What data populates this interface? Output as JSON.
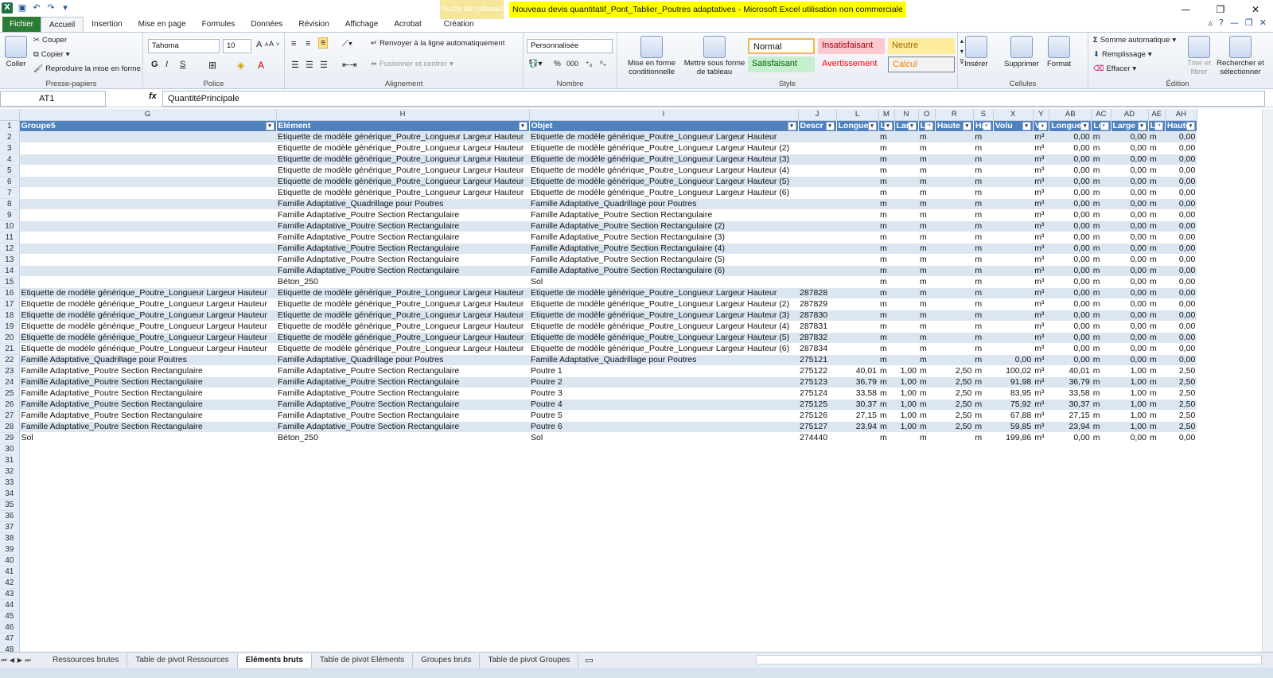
{
  "window": {
    "title": "Nouveau devis quantitatif_Pont_Tablier_Poutres adaptatives  -  Microsoft Excel utilisation non commerciale",
    "context_tab": "Outils de tableau",
    "controls": [
      "—",
      "❐",
      "✕"
    ]
  },
  "tabs": [
    "Fichier",
    "Accueil",
    "Insertion",
    "Mise en page",
    "Formules",
    "Données",
    "Révision",
    "Affichage",
    "Acrobat",
    "Création"
  ],
  "active_tab": "Accueil",
  "ribbon": {
    "clipboard": {
      "paste": "Coller",
      "cut": "Couper",
      "copy": "Copier",
      "format_painter": "Reproduire la mise en forme",
      "label": "Presse-papiers"
    },
    "font": {
      "name": "Tahoma",
      "size": "10",
      "label": "Police"
    },
    "alignment": {
      "wrap": "Renvoyer à la ligne automatiquement",
      "merge": "Fusionner et centrer",
      "label": "Alignement"
    },
    "number": {
      "format": "Personnalisée",
      "label": "Nombre"
    },
    "styles": {
      "conditional": "Mise en forme conditionnelle",
      "table": "Mettre sous forme de tableau",
      "normal": "Normal",
      "insatisfaisant": "Insatisfaisant",
      "neutre": "Neutre",
      "satisfaisant": "Satisfaisant",
      "avertissement": "Avertissement",
      "calcul": "Calcul",
      "label": "Style"
    },
    "cells": {
      "insert": "Insérer",
      "delete": "Supprimer",
      "format": "Format",
      "label": "Cellules"
    },
    "editing": {
      "autosum": "Somme automatique",
      "fill": "Remplissage",
      "clear": "Effacer",
      "sort": "Trier et filtrer",
      "find": "Rechercher et sélectionner",
      "label": "Édition"
    }
  },
  "formula_bar": {
    "name_box": "AT1",
    "fx": "fx",
    "formula": "QuantitéPrincipale"
  },
  "columns": [
    "G",
    "H",
    "I",
    "J",
    "L",
    "M",
    "N",
    "O",
    "R",
    "S",
    "X",
    "Y",
    "AB",
    "AC",
    "AD",
    "AE",
    "AH"
  ],
  "header_row": [
    "Groupe5",
    "Elément",
    "Objet",
    "Descr",
    "Longue",
    "L",
    "Lar",
    "Lar",
    "Haute",
    "Hau",
    "Volu",
    "Vol",
    "Longue",
    "Lon",
    "Large",
    "Lar",
    "Haute"
  ],
  "rows": [
    [
      "",
      "Etiquette de modèle générique_Poutre_Longueur Largeur Hauteur",
      "Etiquette de modèle générique_Poutre_Longueur Largeur Hauteur",
      "",
      "",
      "m",
      "",
      "m",
      "",
      "m",
      "",
      "m³",
      "0,00",
      "m",
      "0,00",
      "m",
      "0,00"
    ],
    [
      "",
      "Etiquette de modèle générique_Poutre_Longueur Largeur Hauteur",
      "Etiquette de modèle générique_Poutre_Longueur Largeur Hauteur (2)",
      "",
      "",
      "m",
      "",
      "m",
      "",
      "m",
      "",
      "m³",
      "0,00",
      "m",
      "0,00",
      "m",
      "0,00"
    ],
    [
      "",
      "Etiquette de modèle générique_Poutre_Longueur Largeur Hauteur",
      "Etiquette de modèle générique_Poutre_Longueur Largeur Hauteur (3)",
      "",
      "",
      "m",
      "",
      "m",
      "",
      "m",
      "",
      "m³",
      "0,00",
      "m",
      "0,00",
      "m",
      "0,00"
    ],
    [
      "",
      "Etiquette de modèle générique_Poutre_Longueur Largeur Hauteur",
      "Etiquette de modèle générique_Poutre_Longueur Largeur Hauteur (4)",
      "",
      "",
      "m",
      "",
      "m",
      "",
      "m",
      "",
      "m³",
      "0,00",
      "m",
      "0,00",
      "m",
      "0,00"
    ],
    [
      "",
      "Etiquette de modèle générique_Poutre_Longueur Largeur Hauteur",
      "Etiquette de modèle générique_Poutre_Longueur Largeur Hauteur (5)",
      "",
      "",
      "m",
      "",
      "m",
      "",
      "m",
      "",
      "m³",
      "0,00",
      "m",
      "0,00",
      "m",
      "0,00"
    ],
    [
      "",
      "Etiquette de modèle générique_Poutre_Longueur Largeur Hauteur",
      "Etiquette de modèle générique_Poutre_Longueur Largeur Hauteur (6)",
      "",
      "",
      "m",
      "",
      "m",
      "",
      "m",
      "",
      "m³",
      "0,00",
      "m",
      "0,00",
      "m",
      "0,00"
    ],
    [
      "",
      "Famille Adaptative_Quadrillage pour Poutres",
      "Famille Adaptative_Quadrillage pour Poutres",
      "",
      "",
      "m",
      "",
      "m",
      "",
      "m",
      "",
      "m³",
      "0,00",
      "m",
      "0,00",
      "m",
      "0,00"
    ],
    [
      "",
      "Famille Adaptative_Poutre Section Rectangulaire",
      "Famille Adaptative_Poutre Section Rectangulaire",
      "",
      "",
      "m",
      "",
      "m",
      "",
      "m",
      "",
      "m³",
      "0,00",
      "m",
      "0,00",
      "m",
      "0,00"
    ],
    [
      "",
      "Famille Adaptative_Poutre Section Rectangulaire",
      "Famille Adaptative_Poutre Section Rectangulaire (2)",
      "",
      "",
      "m",
      "",
      "m",
      "",
      "m",
      "",
      "m³",
      "0,00",
      "m",
      "0,00",
      "m",
      "0,00"
    ],
    [
      "",
      "Famille Adaptative_Poutre Section Rectangulaire",
      "Famille Adaptative_Poutre Section Rectangulaire (3)",
      "",
      "",
      "m",
      "",
      "m",
      "",
      "m",
      "",
      "m³",
      "0,00",
      "m",
      "0,00",
      "m",
      "0,00"
    ],
    [
      "",
      "Famille Adaptative_Poutre Section Rectangulaire",
      "Famille Adaptative_Poutre Section Rectangulaire (4)",
      "",
      "",
      "m",
      "",
      "m",
      "",
      "m",
      "",
      "m³",
      "0,00",
      "m",
      "0,00",
      "m",
      "0,00"
    ],
    [
      "",
      "Famille Adaptative_Poutre Section Rectangulaire",
      "Famille Adaptative_Poutre Section Rectangulaire (5)",
      "",
      "",
      "m",
      "",
      "m",
      "",
      "m",
      "",
      "m³",
      "0,00",
      "m",
      "0,00",
      "m",
      "0,00"
    ],
    [
      "",
      "Famille Adaptative_Poutre Section Rectangulaire",
      "Famille Adaptative_Poutre Section Rectangulaire (6)",
      "",
      "",
      "m",
      "",
      "m",
      "",
      "m",
      "",
      "m³",
      "0,00",
      "m",
      "0,00",
      "m",
      "0,00"
    ],
    [
      "",
      "Béton_250",
      "Sol",
      "",
      "",
      "m",
      "",
      "m",
      "",
      "m",
      "",
      "m³",
      "0,00",
      "m",
      "0,00",
      "m",
      "0,00"
    ],
    [
      "Etiquette de modèle générique_Poutre_Longueur Largeur Hauteur",
      "Etiquette de modèle générique_Poutre_Longueur Largeur Hauteur",
      "Etiquette de modèle générique_Poutre_Longueur Largeur Hauteur",
      "287828",
      "",
      "m",
      "",
      "m",
      "",
      "m",
      "",
      "m³",
      "0,00",
      "m",
      "0,00",
      "m",
      "0,00"
    ],
    [
      "Etiquette de modèle générique_Poutre_Longueur Largeur Hauteur",
      "Etiquette de modèle générique_Poutre_Longueur Largeur Hauteur",
      "Etiquette de modèle générique_Poutre_Longueur Largeur Hauteur (2)",
      "287829",
      "",
      "m",
      "",
      "m",
      "",
      "m",
      "",
      "m³",
      "0,00",
      "m",
      "0,00",
      "m",
      "0,00"
    ],
    [
      "Etiquette de modèle générique_Poutre_Longueur Largeur Hauteur",
      "Etiquette de modèle générique_Poutre_Longueur Largeur Hauteur",
      "Etiquette de modèle générique_Poutre_Longueur Largeur Hauteur (3)",
      "287830",
      "",
      "m",
      "",
      "m",
      "",
      "m",
      "",
      "m³",
      "0,00",
      "m",
      "0,00",
      "m",
      "0,00"
    ],
    [
      "Etiquette de modèle générique_Poutre_Longueur Largeur Hauteur",
      "Etiquette de modèle générique_Poutre_Longueur Largeur Hauteur",
      "Etiquette de modèle générique_Poutre_Longueur Largeur Hauteur (4)",
      "287831",
      "",
      "m",
      "",
      "m",
      "",
      "m",
      "",
      "m³",
      "0,00",
      "m",
      "0,00",
      "m",
      "0,00"
    ],
    [
      "Etiquette de modèle générique_Poutre_Longueur Largeur Hauteur",
      "Etiquette de modèle générique_Poutre_Longueur Largeur Hauteur",
      "Etiquette de modèle générique_Poutre_Longueur Largeur Hauteur (5)",
      "287832",
      "",
      "m",
      "",
      "m",
      "",
      "m",
      "",
      "m³",
      "0,00",
      "m",
      "0,00",
      "m",
      "0,00"
    ],
    [
      "Etiquette de modèle générique_Poutre_Longueur Largeur Hauteur",
      "Etiquette de modèle générique_Poutre_Longueur Largeur Hauteur",
      "Etiquette de modèle générique_Poutre_Longueur Largeur Hauteur (6)",
      "287834",
      "",
      "m",
      "",
      "m",
      "",
      "m",
      "",
      "m³",
      "0,00",
      "m",
      "0,00",
      "m",
      "0,00"
    ],
    [
      "Famille Adaptative_Quadrillage pour Poutres",
      "Famille Adaptative_Quadrillage pour Poutres",
      "Famille Adaptative_Quadrillage pour Poutres",
      "275121",
      "",
      "m",
      "",
      "m",
      "",
      "m",
      "0,00",
      "m³",
      "0,00",
      "m",
      "0,00",
      "m",
      "0,00"
    ],
    [
      "Famille Adaptative_Poutre Section Rectangulaire",
      "Famille Adaptative_Poutre Section Rectangulaire",
      "Poutre 1",
      "275122",
      "40,01",
      "m",
      "1,00",
      "m",
      "2,50",
      "m",
      "100,02",
      "m³",
      "40,01",
      "m",
      "1,00",
      "m",
      "2,50"
    ],
    [
      "Famille Adaptative_Poutre Section Rectangulaire",
      "Famille Adaptative_Poutre Section Rectangulaire",
      "Poutre 2",
      "275123",
      "36,79",
      "m",
      "1,00",
      "m",
      "2,50",
      "m",
      "91,98",
      "m³",
      "36,79",
      "m",
      "1,00",
      "m",
      "2,50"
    ],
    [
      "Famille Adaptative_Poutre Section Rectangulaire",
      "Famille Adaptative_Poutre Section Rectangulaire",
      "Poutre 3",
      "275124",
      "33,58",
      "m",
      "1,00",
      "m",
      "2,50",
      "m",
      "83,95",
      "m³",
      "33,58",
      "m",
      "1,00",
      "m",
      "2,50"
    ],
    [
      "Famille Adaptative_Poutre Section Rectangulaire",
      "Famille Adaptative_Poutre Section Rectangulaire",
      "Poutre 4",
      "275125",
      "30,37",
      "m",
      "1,00",
      "m",
      "2,50",
      "m",
      "75,92",
      "m³",
      "30,37",
      "m",
      "1,00",
      "m",
      "2,50"
    ],
    [
      "Famille Adaptative_Poutre Section Rectangulaire",
      "Famille Adaptative_Poutre Section Rectangulaire",
      "Poutre 5",
      "275126",
      "27,15",
      "m",
      "1,00",
      "m",
      "2,50",
      "m",
      "67,88",
      "m³",
      "27,15",
      "m",
      "1,00",
      "m",
      "2,50"
    ],
    [
      "Famille Adaptative_Poutre Section Rectangulaire",
      "Famille Adaptative_Poutre Section Rectangulaire",
      "Poutre 6",
      "275127",
      "23,94",
      "m",
      "1,00",
      "m",
      "2,50",
      "m",
      "59,85",
      "m³",
      "23,94",
      "m",
      "1,00",
      "m",
      "2,50"
    ],
    [
      "Sol",
      "Béton_250",
      "Sol",
      "274440",
      "",
      "m",
      "",
      "m",
      "",
      "m",
      "199,86",
      "m³",
      "0,00",
      "m",
      "0,00",
      "m",
      "0,00"
    ]
  ],
  "empty_rows_to": 48,
  "sheet_tabs": [
    "Ressources brutes",
    "Table de pivot Ressources",
    "Eléments bruts",
    "Table de pivot Eléments",
    "Groupes bruts",
    "Table de pivot Groupes"
  ],
  "active_sheet": "Eléments bruts"
}
